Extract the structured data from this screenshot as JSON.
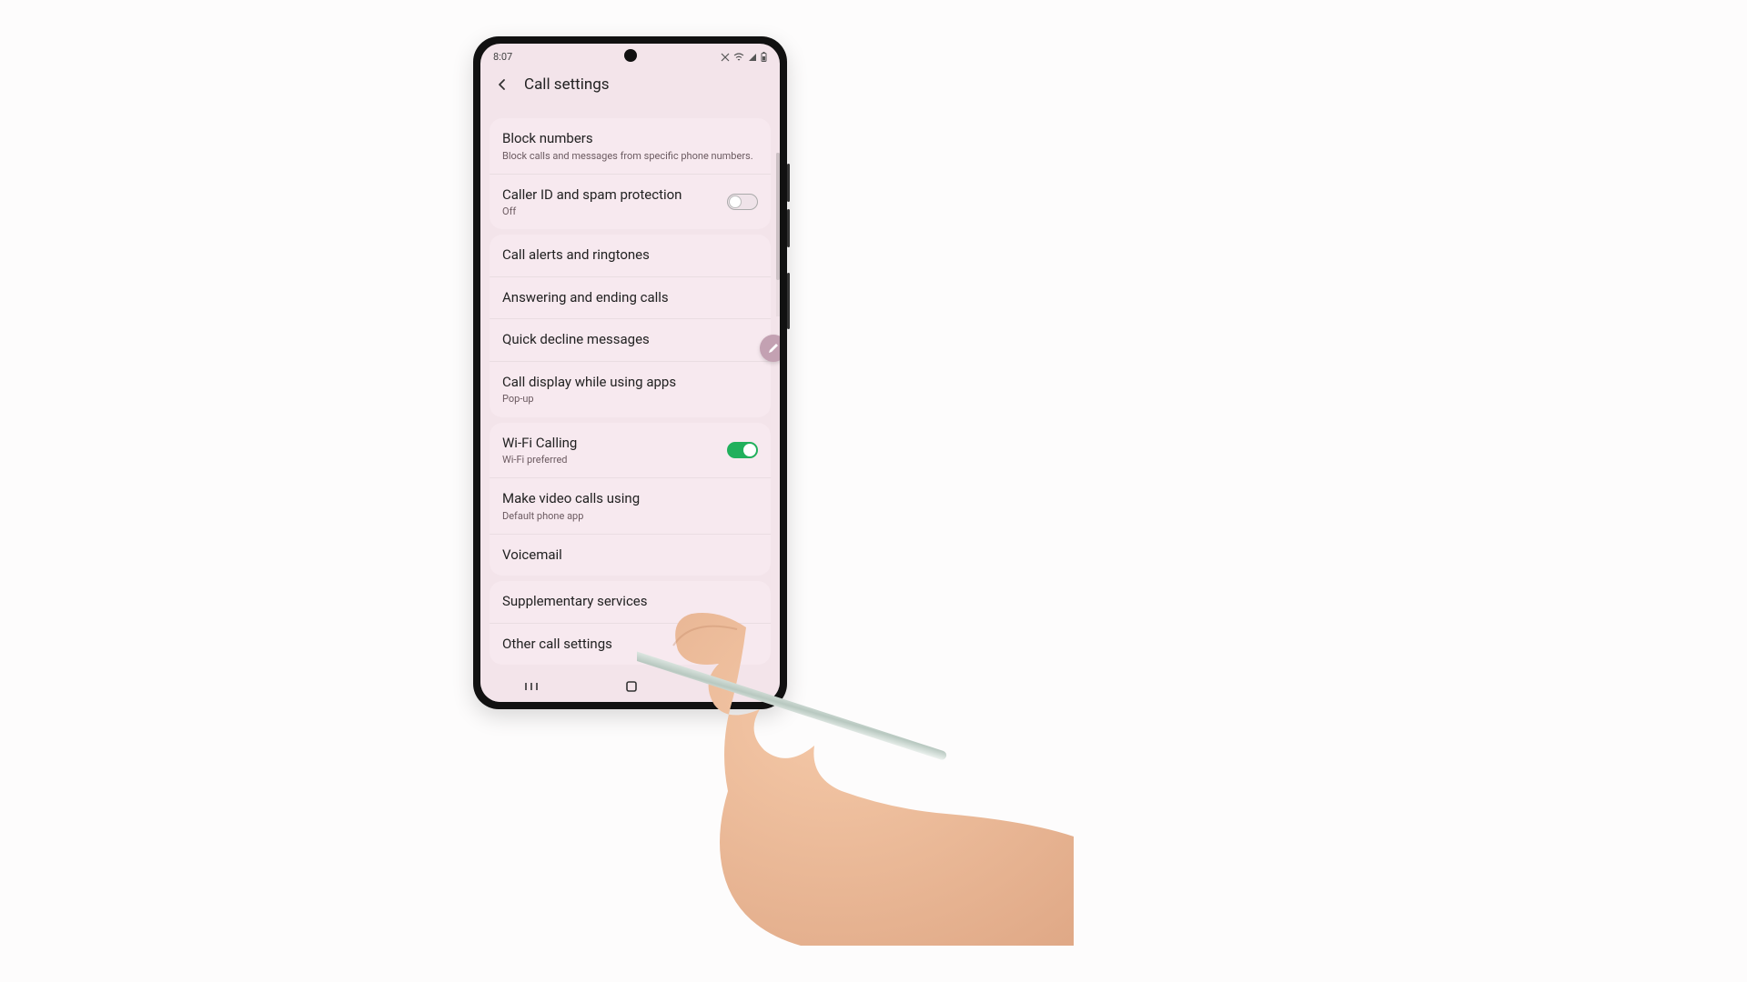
{
  "status": {
    "time": "8:07",
    "icons": [
      "no-sim-icon",
      "wifi-icon",
      "signal-icon",
      "battery-icon"
    ]
  },
  "appbar": {
    "title": "Call settings"
  },
  "groups": [
    {
      "items": [
        {
          "title": "Block numbers",
          "sub": "Block calls and messages from specific phone numbers.",
          "toggle": null
        },
        {
          "title": "Caller ID and spam protection",
          "sub": "Off",
          "toggle": false
        }
      ]
    },
    {
      "items": [
        {
          "title": "Call alerts and ringtones",
          "sub": null,
          "toggle": null
        },
        {
          "title": "Answering and ending calls",
          "sub": null,
          "toggle": null
        },
        {
          "title": "Quick decline messages",
          "sub": null,
          "toggle": null
        },
        {
          "title": "Call display while using apps",
          "sub": "Pop-up",
          "toggle": null
        }
      ]
    },
    {
      "items": [
        {
          "title": "Wi-Fi Calling",
          "sub": "Wi-Fi preferred",
          "toggle": true
        },
        {
          "title": "Make video calls using",
          "sub": "Default phone app",
          "toggle": null
        },
        {
          "title": "Voicemail",
          "sub": null,
          "toggle": null
        }
      ]
    },
    {
      "items": [
        {
          "title": "Supplementary services",
          "sub": null,
          "toggle": null
        },
        {
          "title": "Other call settings",
          "sub": null,
          "toggle": null
        }
      ]
    }
  ],
  "colors": {
    "screen_bg": "#f3e4ea",
    "card_bg": "#f7e9ef",
    "toggle_on": "#21b05c",
    "fab_bg": "#c3a1b2"
  }
}
